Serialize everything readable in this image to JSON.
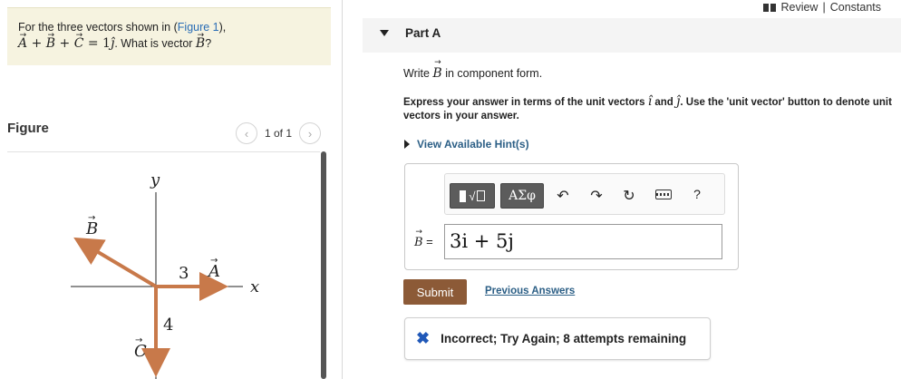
{
  "question": {
    "line1_prefix": "For the three vectors shown in (",
    "figure_link": "Figure 1",
    "line1_suffix": "),",
    "eq_A": "A",
    "eq_plus1": " + ",
    "eq_B": "B",
    "eq_plus2": " + ",
    "eq_C": "C",
    "eq_equals": " = 1",
    "eq_j": "ĵ",
    "eq_end": ". What is vector ",
    "eq_B2": "B",
    "eq_q": "?"
  },
  "figure_panel": {
    "title": "Figure",
    "pager_text": "1 of 1",
    "prev_icon": "chevron-left-icon",
    "next_icon": "chevron-right-icon"
  },
  "diagram": {
    "y_axis_label": "y",
    "x_axis_label": "x",
    "vector_a_label": "A",
    "vector_b_label": "B",
    "vector_c_label": "C",
    "a_length_label": "3",
    "c_length_label": "4",
    "vector_color": "#c8794a"
  },
  "header": {
    "review": "Review",
    "separator": "|",
    "constants": "Constants"
  },
  "part": {
    "title": "Part A",
    "write_prefix": "Write ",
    "write_symbol": "B",
    "write_suffix": " in component form.",
    "express_text_1": "Express your answer in terms of the unit vectors ",
    "unit_i": "î",
    "express_and": " and ",
    "unit_j": "ĵ",
    "express_text_2": ". Use the 'unit vector' button to denote unit vectors in your answer.",
    "hints_label": "View Available Hint(s)"
  },
  "toolbar": {
    "templates_icon": "templates-icon",
    "greek_label": "ΑΣφ",
    "undo_icon": "undo-icon",
    "redo_icon": "redo-icon",
    "reset_icon": "reset-icon",
    "keyboard_icon": "keyboard-icon",
    "help_label": "?"
  },
  "answer": {
    "label": "B =",
    "value": "3i + 5j"
  },
  "actions": {
    "submit": "Submit",
    "previous_answers": "Previous Answers"
  },
  "feedback": {
    "icon": "x-icon",
    "text": "Incorrect; Try Again; 8 attempts remaining",
    "icon_color": "#2058b8"
  }
}
